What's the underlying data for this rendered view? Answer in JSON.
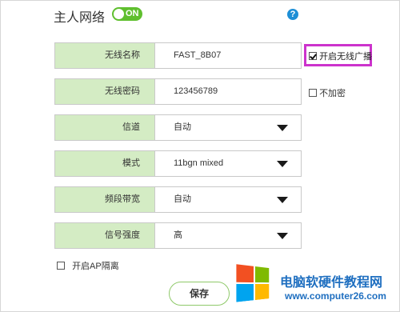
{
  "header": {
    "title": "主人网络",
    "toggle_label": "ON",
    "help_icon": "?"
  },
  "form": {
    "rows": [
      {
        "label": "无线名称",
        "value": "FAST_8B07",
        "dropdown": false
      },
      {
        "label": "无线密码",
        "value": "123456789",
        "dropdown": false
      },
      {
        "label": "信道",
        "value": "自动",
        "dropdown": true
      },
      {
        "label": "模式",
        "value": "11bgn mixed",
        "dropdown": true
      },
      {
        "label": "频段带宽",
        "value": "自动",
        "dropdown": true
      },
      {
        "label": "信号强度",
        "value": "高",
        "dropdown": true
      }
    ],
    "broadcast_label": "开启无线广播",
    "broadcast_checked": true,
    "no_encrypt_label": "不加密",
    "no_encrypt_checked": false,
    "ap_isolation_label": "开启AP隔离",
    "ap_isolation_checked": false,
    "save_label": "保存"
  },
  "watermark": {
    "title": "电脑软硬件教程网",
    "url": "www.computer26.com"
  },
  "colors": {
    "label_bg": "#d4ecc4",
    "toggle_on": "#5fbf2e",
    "highlight": "#cc33cc",
    "help_icon": "#1e8fd6",
    "watermark_text": "#1f6fc0"
  }
}
